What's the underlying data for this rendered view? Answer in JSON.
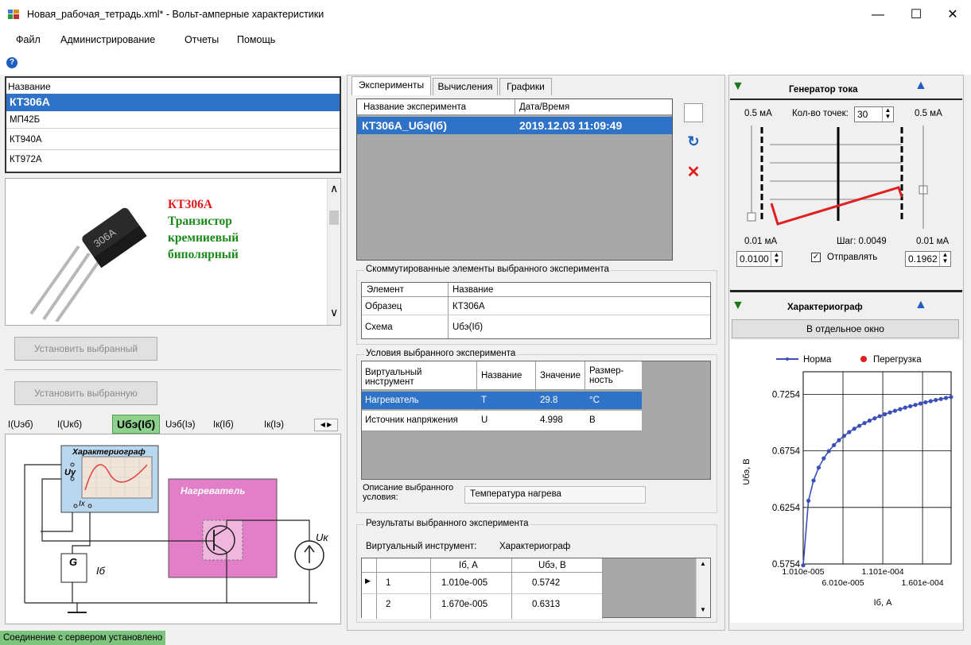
{
  "window": {
    "title": "Новая_рабочая_тетрадь.xml* - Вольт-амперные характеристики",
    "minimize": "—",
    "maximize": "☐",
    "close": "✕"
  },
  "menu": [
    "Файл",
    "Администрирование",
    "Отчеты",
    "Помощь"
  ],
  "help": "?",
  "device_list": {
    "header": "Название",
    "items": [
      "КТ306А",
      "МП42Б",
      "КТ940А",
      "КТ972А"
    ],
    "selected": 0
  },
  "description": {
    "lines": [
      "КТ306А",
      "Транзистор",
      "кремниевый",
      "биполярный"
    ],
    "colors": [
      "#e01a1a",
      "#1a8a1a",
      "#1a8a1a",
      "#1a8a1a"
    ],
    "package_marking": "306А"
  },
  "buttons": {
    "install_device": "Установить выбранный",
    "install_scheme": "Установить выбранную"
  },
  "scheme_tabs": {
    "items": [
      "I(Uэб)",
      "I(Uкб)",
      "Uбэ(Iб)",
      "Uэб(Iэ)",
      "Iк(Iб)",
      "Iк(Iэ)"
    ],
    "selected": 2,
    "nav": [
      "◀",
      "▶"
    ]
  },
  "circuit": {
    "characterograph": "Характериограф",
    "heater": "Нагреватель",
    "uy": "Uy",
    "ix": "Ix",
    "g": "G",
    "ib": "Iб",
    "uk": "Uк"
  },
  "main_tabs": {
    "items": [
      "Эксперименты",
      "Вычисления",
      "Графики"
    ],
    "selected": 0
  },
  "experiments": {
    "headers": [
      "Название эксперимента",
      "Дата/Время"
    ],
    "rows": [
      [
        "КТ306А_Uбэ(Iб)",
        "2019.12.03 11:09:49"
      ]
    ]
  },
  "commuted": {
    "title": "Скоммутированные элементы выбранного эксперимента",
    "headers": [
      "Элемент",
      "Название"
    ],
    "rows": [
      [
        "Образец",
        "КТ306А"
      ],
      [
        "Схема",
        "Uбэ(Iб)"
      ]
    ]
  },
  "conditions": {
    "title": "Условия выбранного эксперимента",
    "headers": [
      "Виртуальный инструмент",
      "Название",
      "Значение",
      "Размер-ность"
    ],
    "rows": [
      [
        "Нагреватель",
        "T",
        "29.8",
        "°C"
      ],
      [
        "Источник напряжения",
        "U",
        "4.998",
        "В"
      ]
    ],
    "desc_label": "Описание выбранного условия:",
    "desc_value": "Температура нагрева"
  },
  "results": {
    "title": "Результаты выбранного эксперимента",
    "instrument_label": "Виртуальный инструмент:",
    "instrument": "Характериограф",
    "headers": [
      "",
      "Iб, А",
      "Uбэ, В"
    ],
    "rows": [
      [
        "1",
        "1.010e-005",
        "0.5742"
      ],
      [
        "2",
        "1.670e-005",
        "0.6313"
      ]
    ]
  },
  "generator": {
    "title": "Генератор тока",
    "top_left": "0.5 мА",
    "points_label": "Кол-во точек:",
    "points": "30",
    "top_right": "0.5 мА",
    "bottom_left": "0.01 мА",
    "step": "Шаг: 0.0049",
    "bottom_right": "0.01 мА",
    "min_val": "0.0100",
    "send_label": "Отправлять",
    "max_val": "0.1962",
    "signal_color": "#e02020"
  },
  "characterograph": {
    "title": "Характериограф",
    "open_window": "В отдельное окно"
  },
  "chart_data": {
    "type": "line",
    "legend": [
      {
        "name": "Норма",
        "color": "#3a50b8"
      },
      {
        "name": "Перегрузка",
        "color": "#e02020"
      }
    ],
    "legend_position": "top",
    "xlabel": "Iб, А",
    "ylabel": "Uбэ, В",
    "xlim": [
      1.01e-05,
      0.000196
    ],
    "ylim": [
      0.5754,
      0.7454
    ],
    "xticks": [
      "1.010e-005",
      "6.010e-005",
      "1.101e-004",
      "1.601e-004"
    ],
    "yticks": [
      "0.5754",
      "0.6254",
      "0.6754",
      "0.7254"
    ],
    "grid": true,
    "series": [
      {
        "name": "Норма",
        "x": [
          1.01e-05,
          1.67e-05,
          2.31e-05,
          2.95e-05,
          3.59e-05,
          4.23e-05,
          4.87e-05,
          5.51e-05,
          6.15e-05,
          6.79e-05,
          7.43e-05,
          8.07e-05,
          8.71e-05,
          9.35e-05,
          9.99e-05,
          0.0001063,
          0.0001127,
          0.0001191,
          0.0001255,
          0.0001319,
          0.0001383,
          0.0001447,
          0.0001511,
          0.0001575,
          0.0001639,
          0.0001703,
          0.0001767,
          0.0001831,
          0.0001895,
          0.0001959
        ],
        "y": [
          0.5742,
          0.6313,
          0.6492,
          0.6606,
          0.6688,
          0.6752,
          0.6805,
          0.6849,
          0.6887,
          0.692,
          0.695,
          0.6976,
          0.7,
          0.7022,
          0.7042,
          0.7061,
          0.7078,
          0.7094,
          0.7109,
          0.7123,
          0.7137,
          0.7149,
          0.7161,
          0.7173,
          0.7184,
          0.7194,
          0.7204,
          0.7213,
          0.7222,
          0.7231
        ]
      }
    ]
  },
  "status": "Соединение с сервером установлено"
}
